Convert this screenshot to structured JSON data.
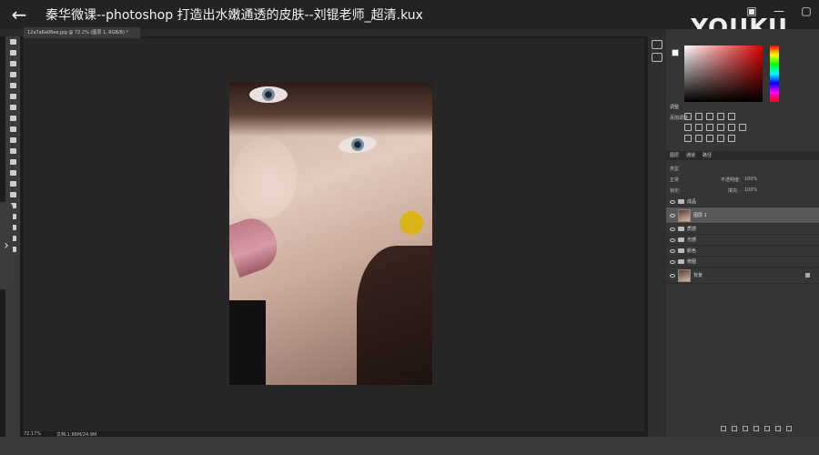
{
  "player": {
    "title": "秦华微课--photoshop 打造出水嫩通透的皮肤--刘锟老师_超清.kux",
    "back_icon": "arrow-left-icon",
    "watermark": "YOUKU",
    "window_buttons": [
      "mini-player-icon",
      "minimize-icon",
      "maximize-icon"
    ]
  },
  "document": {
    "tab_label": "12a7a6a06ee.jpg @ 72.2% (图层 1, RGB/8) *",
    "zoom": "72.17%",
    "doc_info": "文档:1.86M/24.9M"
  },
  "panels": {
    "adjustments_tab": "调整",
    "adjustments_label": "添加调整",
    "layer_tabs": [
      "图层",
      "通道",
      "路径"
    ],
    "filter_kind": "类型",
    "blend_mode": "正常",
    "opacity_label": "不透明度:",
    "opacity_value": "100%",
    "lock_label": "锁定:",
    "fill_label": "填充:",
    "fill_value": "100%",
    "layers": [
      {
        "name": "成品",
        "kind": "folder"
      },
      {
        "name": "图层 1",
        "kind": "layer",
        "selected": true
      },
      {
        "name": "质感",
        "kind": "folder"
      },
      {
        "name": "光感",
        "kind": "folder"
      },
      {
        "name": "颜色",
        "kind": "folder"
      },
      {
        "name": "修图",
        "kind": "folder"
      },
      {
        "name": "背景",
        "kind": "background"
      }
    ]
  },
  "colors": {
    "foreground": "#ffffff",
    "background": "#000000"
  }
}
